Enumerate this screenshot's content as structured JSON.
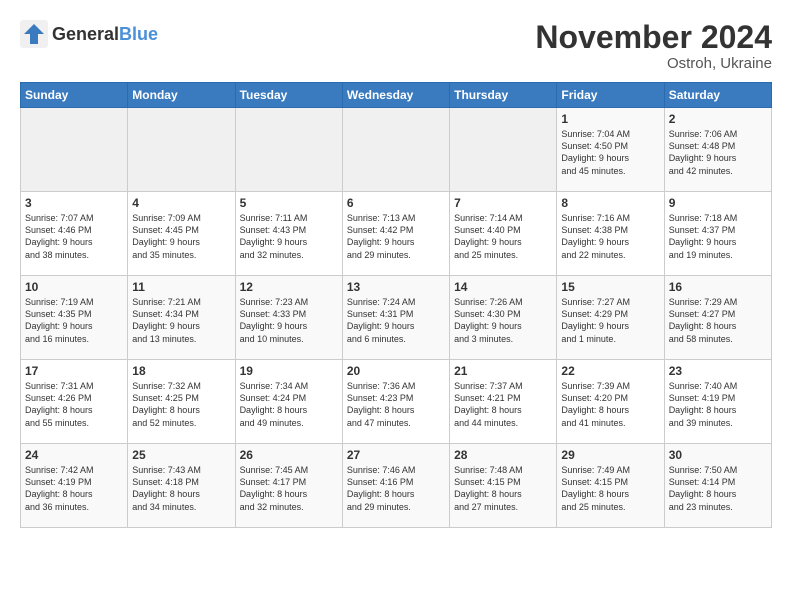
{
  "logo": {
    "text_general": "General",
    "text_blue": "Blue"
  },
  "title": "November 2024",
  "location": "Ostroh, Ukraine",
  "weekdays": [
    "Sunday",
    "Monday",
    "Tuesday",
    "Wednesday",
    "Thursday",
    "Friday",
    "Saturday"
  ],
  "weeks": [
    [
      {
        "day": "",
        "info": ""
      },
      {
        "day": "",
        "info": ""
      },
      {
        "day": "",
        "info": ""
      },
      {
        "day": "",
        "info": ""
      },
      {
        "day": "",
        "info": ""
      },
      {
        "day": "1",
        "info": "Sunrise: 7:04 AM\nSunset: 4:50 PM\nDaylight: 9 hours\nand 45 minutes."
      },
      {
        "day": "2",
        "info": "Sunrise: 7:06 AM\nSunset: 4:48 PM\nDaylight: 9 hours\nand 42 minutes."
      }
    ],
    [
      {
        "day": "3",
        "info": "Sunrise: 7:07 AM\nSunset: 4:46 PM\nDaylight: 9 hours\nand 38 minutes."
      },
      {
        "day": "4",
        "info": "Sunrise: 7:09 AM\nSunset: 4:45 PM\nDaylight: 9 hours\nand 35 minutes."
      },
      {
        "day": "5",
        "info": "Sunrise: 7:11 AM\nSunset: 4:43 PM\nDaylight: 9 hours\nand 32 minutes."
      },
      {
        "day": "6",
        "info": "Sunrise: 7:13 AM\nSunset: 4:42 PM\nDaylight: 9 hours\nand 29 minutes."
      },
      {
        "day": "7",
        "info": "Sunrise: 7:14 AM\nSunset: 4:40 PM\nDaylight: 9 hours\nand 25 minutes."
      },
      {
        "day": "8",
        "info": "Sunrise: 7:16 AM\nSunset: 4:38 PM\nDaylight: 9 hours\nand 22 minutes."
      },
      {
        "day": "9",
        "info": "Sunrise: 7:18 AM\nSunset: 4:37 PM\nDaylight: 9 hours\nand 19 minutes."
      }
    ],
    [
      {
        "day": "10",
        "info": "Sunrise: 7:19 AM\nSunset: 4:35 PM\nDaylight: 9 hours\nand 16 minutes."
      },
      {
        "day": "11",
        "info": "Sunrise: 7:21 AM\nSunset: 4:34 PM\nDaylight: 9 hours\nand 13 minutes."
      },
      {
        "day": "12",
        "info": "Sunrise: 7:23 AM\nSunset: 4:33 PM\nDaylight: 9 hours\nand 10 minutes."
      },
      {
        "day": "13",
        "info": "Sunrise: 7:24 AM\nSunset: 4:31 PM\nDaylight: 9 hours\nand 6 minutes."
      },
      {
        "day": "14",
        "info": "Sunrise: 7:26 AM\nSunset: 4:30 PM\nDaylight: 9 hours\nand 3 minutes."
      },
      {
        "day": "15",
        "info": "Sunrise: 7:27 AM\nSunset: 4:29 PM\nDaylight: 9 hours\nand 1 minute."
      },
      {
        "day": "16",
        "info": "Sunrise: 7:29 AM\nSunset: 4:27 PM\nDaylight: 8 hours\nand 58 minutes."
      }
    ],
    [
      {
        "day": "17",
        "info": "Sunrise: 7:31 AM\nSunset: 4:26 PM\nDaylight: 8 hours\nand 55 minutes."
      },
      {
        "day": "18",
        "info": "Sunrise: 7:32 AM\nSunset: 4:25 PM\nDaylight: 8 hours\nand 52 minutes."
      },
      {
        "day": "19",
        "info": "Sunrise: 7:34 AM\nSunset: 4:24 PM\nDaylight: 8 hours\nand 49 minutes."
      },
      {
        "day": "20",
        "info": "Sunrise: 7:36 AM\nSunset: 4:23 PM\nDaylight: 8 hours\nand 47 minutes."
      },
      {
        "day": "21",
        "info": "Sunrise: 7:37 AM\nSunset: 4:21 PM\nDaylight: 8 hours\nand 44 minutes."
      },
      {
        "day": "22",
        "info": "Sunrise: 7:39 AM\nSunset: 4:20 PM\nDaylight: 8 hours\nand 41 minutes."
      },
      {
        "day": "23",
        "info": "Sunrise: 7:40 AM\nSunset: 4:19 PM\nDaylight: 8 hours\nand 39 minutes."
      }
    ],
    [
      {
        "day": "24",
        "info": "Sunrise: 7:42 AM\nSunset: 4:19 PM\nDaylight: 8 hours\nand 36 minutes."
      },
      {
        "day": "25",
        "info": "Sunrise: 7:43 AM\nSunset: 4:18 PM\nDaylight: 8 hours\nand 34 minutes."
      },
      {
        "day": "26",
        "info": "Sunrise: 7:45 AM\nSunset: 4:17 PM\nDaylight: 8 hours\nand 32 minutes."
      },
      {
        "day": "27",
        "info": "Sunrise: 7:46 AM\nSunset: 4:16 PM\nDaylight: 8 hours\nand 29 minutes."
      },
      {
        "day": "28",
        "info": "Sunrise: 7:48 AM\nSunset: 4:15 PM\nDaylight: 8 hours\nand 27 minutes."
      },
      {
        "day": "29",
        "info": "Sunrise: 7:49 AM\nSunset: 4:15 PM\nDaylight: 8 hours\nand 25 minutes."
      },
      {
        "day": "30",
        "info": "Sunrise: 7:50 AM\nSunset: 4:14 PM\nDaylight: 8 hours\nand 23 minutes."
      }
    ]
  ]
}
